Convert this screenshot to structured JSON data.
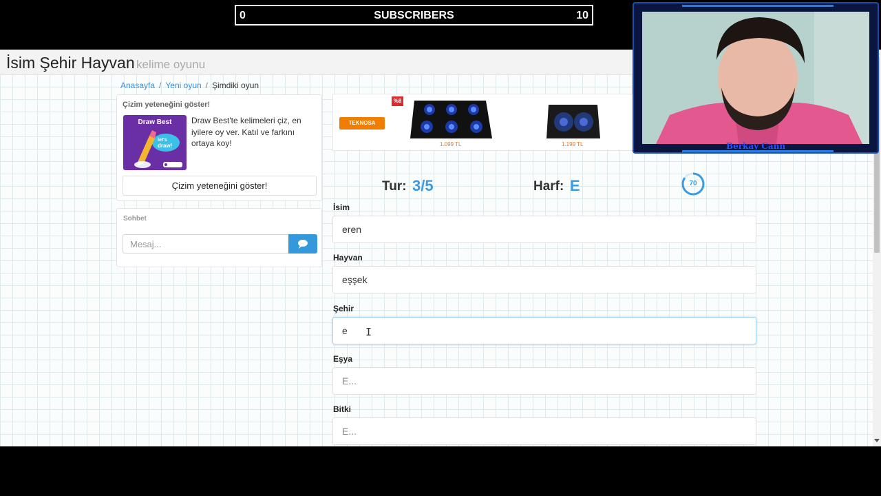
{
  "stream": {
    "subscribers_current": "0",
    "subscribers_label": "SUBSCRIBERS",
    "subscribers_goal": "10",
    "webcam_name": "Berkay Cann"
  },
  "site": {
    "title": "İsim Şehir Hayvan",
    "subtitle": "kelime oyunu"
  },
  "breadcrumb": [
    "Anasayfa",
    "Yeni oyun",
    "Şimdiki oyun"
  ],
  "draw_panel": {
    "heading": "Çizim yeteneğini göster!",
    "banner_title": "Draw Best",
    "banner_badge": "let's draw!",
    "description": "Draw Best'te kelimeleri çiz, en iyilere oy ver. Katıl ve farkını ortaya koy!",
    "button_label": "Çizim yeteneğini göster!"
  },
  "chat": {
    "heading": "Sohbet",
    "placeholder": "Mesaj..."
  },
  "ad": {
    "brand": "TEKNOSA",
    "badge": "%8",
    "price_1": "1.099 TL",
    "price_2": "1.199 TL"
  },
  "round": {
    "tur_label": "Tur:",
    "tur_value": "3/5",
    "harf_label": "Harf:",
    "harf_value": "E",
    "timer": "70"
  },
  "form": {
    "isim_label": "İsim",
    "isim_value": "eren",
    "hayvan_label": "Hayvan",
    "hayvan_value": "eşşek",
    "sehir_label": "Şehir",
    "sehir_value": "e",
    "esya_label": "Eşya",
    "esya_placeholder": "E...",
    "bitki_label": "Bitki",
    "bitki_placeholder": "E..."
  },
  "colors": {
    "accent": "#3a9be0",
    "send_button": "#3498db",
    "banner": "#6a2ea5",
    "webcam_frame": "#1e4fb0"
  }
}
